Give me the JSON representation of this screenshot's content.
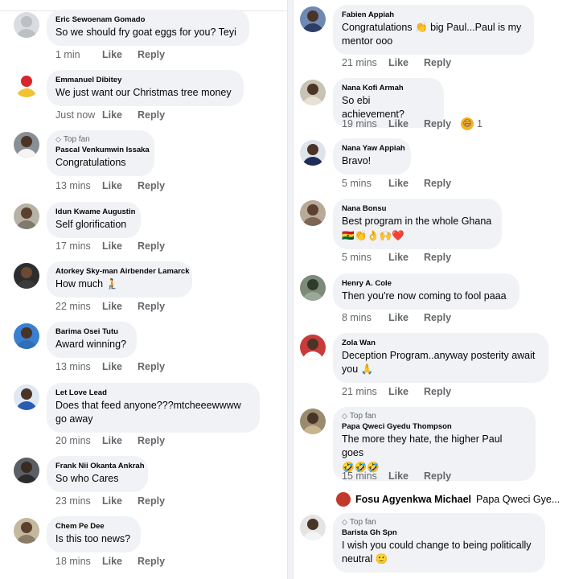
{
  "left": [
    {
      "name": "Eric Sewoenam Gomado",
      "text": "So we should fry goat eggs for you? Teyi",
      "time": "1 min",
      "like": "Like",
      "reply": "Reply",
      "avatar_bg": "#d9dce1",
      "face": "#bcc0c4",
      "body": "#bcc0c4"
    },
    {
      "name": "Emmanuel Dibitey",
      "text": "We just want our Christmas tree money",
      "time": "Just now",
      "like": "Like",
      "reply": "Reply",
      "avatar_bg": "#ffffff",
      "face": "#d8262c",
      "body": "#f2c230"
    },
    {
      "badge": "Top fan",
      "name": "Pascal Venkumwin Issaka",
      "text": "Congratulations",
      "time": "13 mins",
      "like": "Like",
      "reply": "Reply",
      "avatar_bg": "#8a8f96",
      "face": "#4a3426",
      "body": "#f4f4f4"
    },
    {
      "name": "Idun Kwame Augustin",
      "text": "Self glorification",
      "time": "17 mins",
      "like": "Like",
      "reply": "Reply",
      "avatar_bg": "#b7b2a6",
      "face": "#5c4030",
      "body": "#7f7a6d"
    },
    {
      "name": "Atorkey Sky-man Airbender Lamarck",
      "text": "How much 🧎",
      "time": "22 mins",
      "like": "Like",
      "reply": "Reply",
      "avatar_bg": "#2d2d2d",
      "face": "#6a4a32",
      "body": "#3b3b3b"
    },
    {
      "name": "Barima Osei Tutu",
      "text": "Award winning?",
      "time": "13 mins",
      "like": "Like",
      "reply": "Reply",
      "avatar_bg": "#3a7fd0",
      "face": "#4a3426",
      "body": "#2f6eb9"
    },
    {
      "name": "Let Love Lead",
      "text": "Does that feed anyone???mtcheeewwww go away",
      "time": "20 mins",
      "like": "Like",
      "reply": "Reply",
      "avatar_bg": "#dfe7f2",
      "face": "#4a3426",
      "body": "#2a5db0"
    },
    {
      "name": "Frank Nii Okanta Ankrah",
      "text": "So who Cares",
      "time": "23 mins",
      "like": "Like",
      "reply": "Reply",
      "avatar_bg": "#5a5f66",
      "face": "#3a2a20",
      "body": "#2c2c2c"
    },
    {
      "name": "Chem Pe Dee",
      "text": "Is this too news?",
      "time": "18 mins",
      "like": "Like",
      "reply": "Reply",
      "avatar_bg": "#c4b89f",
      "face": "#5c4030",
      "body": "#8a7d68"
    }
  ],
  "right": [
    {
      "name": "Fabien Appiah",
      "text": "Congratulations 👏 big Paul...Paul is my mentor ooo",
      "time": "21 mins",
      "like": "Like",
      "reply": "Reply",
      "avatar_bg": "#6f89b3",
      "face": "#4a3426",
      "body": "#2c3e63"
    },
    {
      "name": "Nana Kofi Armah",
      "text": "So ebi achievement?",
      "time": "19 mins",
      "like": "Like",
      "reply": "Reply",
      "reaction_count": "1",
      "avatar_bg": "#c9c3b6",
      "face": "#4a3426",
      "body": "#e8e2d6"
    },
    {
      "name": "Nana Yaw Appiah",
      "text": "Bravo!",
      "time": "5 mins",
      "like": "Like",
      "reply": "Reply",
      "avatar_bg": "#dfe3ea",
      "face": "#4a3426",
      "body": "#1d2c5a"
    },
    {
      "name": "Nana Bonsu",
      "text": "Best program in the whole Ghana",
      "emojis": "🇬🇭👏👌🙌❤️",
      "time": "5 mins",
      "like": "Like",
      "reply": "Reply",
      "avatar_bg": "#b9a998",
      "face": "#5c4030",
      "body": "#7c6552"
    },
    {
      "name": "Henry A. Cole",
      "text": "Then you're now coming to fool paaa",
      "time": "8 mins",
      "like": "Like",
      "reply": "Reply",
      "avatar_bg": "#7d8a7a",
      "face": "#2f3b2c",
      "body": "#9aa896"
    },
    {
      "name": "Zola Wan",
      "text": "Deception Program..anyway posterity await you 🙏",
      "time": "21 mins",
      "like": "Like",
      "reply": "Reply",
      "avatar_bg": "#c93b3b",
      "face": "#4a3426",
      "body": "#ffffff"
    },
    {
      "badge": "Top fan",
      "name": "Papa Qweci Gyedu Thompson",
      "text": "The more they hate, the higher Paul goes",
      "emojis": "🤣🤣🤣",
      "time": "15 mins",
      "like": "Like",
      "reply": "Reply",
      "avatar_bg": "#9a8b6f",
      "face": "#4a3426",
      "body": "#c8b58d"
    },
    {
      "badge": "Top fan",
      "name": "Barista Gh Spn",
      "text": "I wish you could change to being politically neutral 🙂",
      "avatar_bg": "#e4e4e4",
      "face": "#4a3426",
      "body": "#f4f4f4"
    }
  ],
  "reply_preview": {
    "name": "Fosu Agyenkwa Michael",
    "text": "Papa Qweci Gye..."
  },
  "colors": {
    "bubble": "#f0f2f5",
    "meta": "#65676b",
    "text": "#050505"
  }
}
